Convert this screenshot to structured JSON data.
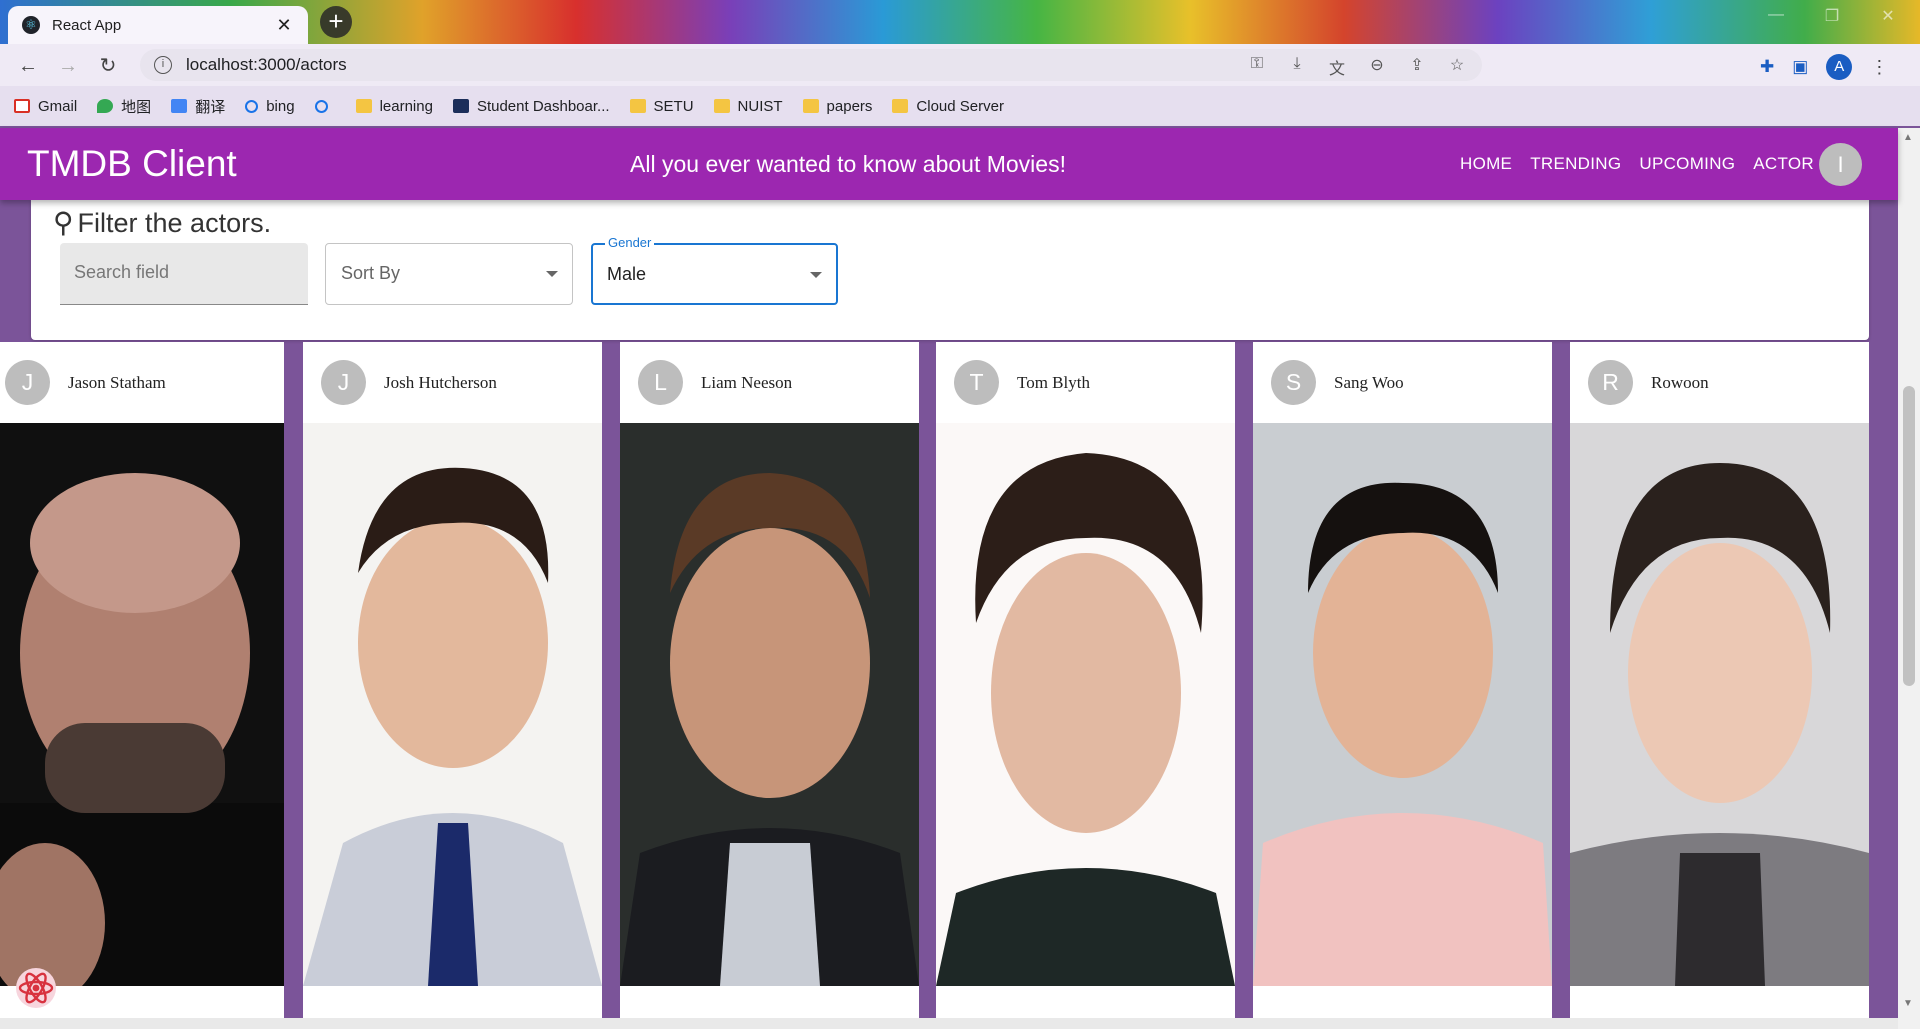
{
  "browser": {
    "tab_title": "React App",
    "tab_close": "✕",
    "new_tab": "+",
    "url": "localhost:3000/actors",
    "bookmarks": [
      "Gmail",
      "地图",
      "翻译",
      "bing",
      "",
      "learning",
      "Student Dashboar...",
      "SETU",
      "NUIST",
      "papers",
      "Cloud Server"
    ],
    "profile_initial": "A"
  },
  "app": {
    "title": "TMDB Client",
    "tagline": "All you ever wanted to know about Movies!",
    "nav": [
      "HOME",
      "TRENDING",
      "UPCOMING",
      "ACTOR"
    ],
    "avatar_initial": "I",
    "accent": "#9c27b0"
  },
  "filter": {
    "title": "Filter the actors.",
    "search_placeholder": "Search field",
    "sort_placeholder": "Sort By",
    "gender_label": "Gender",
    "gender_value": "Male"
  },
  "actors": [
    {
      "initial": "J",
      "name": "Jason Statham"
    },
    {
      "initial": "J",
      "name": "Josh Hutcherson"
    },
    {
      "initial": "L",
      "name": "Liam Neeson"
    },
    {
      "initial": "T",
      "name": "Tom Blyth"
    },
    {
      "initial": "S",
      "name": "Sang Woo"
    },
    {
      "initial": "R",
      "name": "Rowoon"
    }
  ]
}
